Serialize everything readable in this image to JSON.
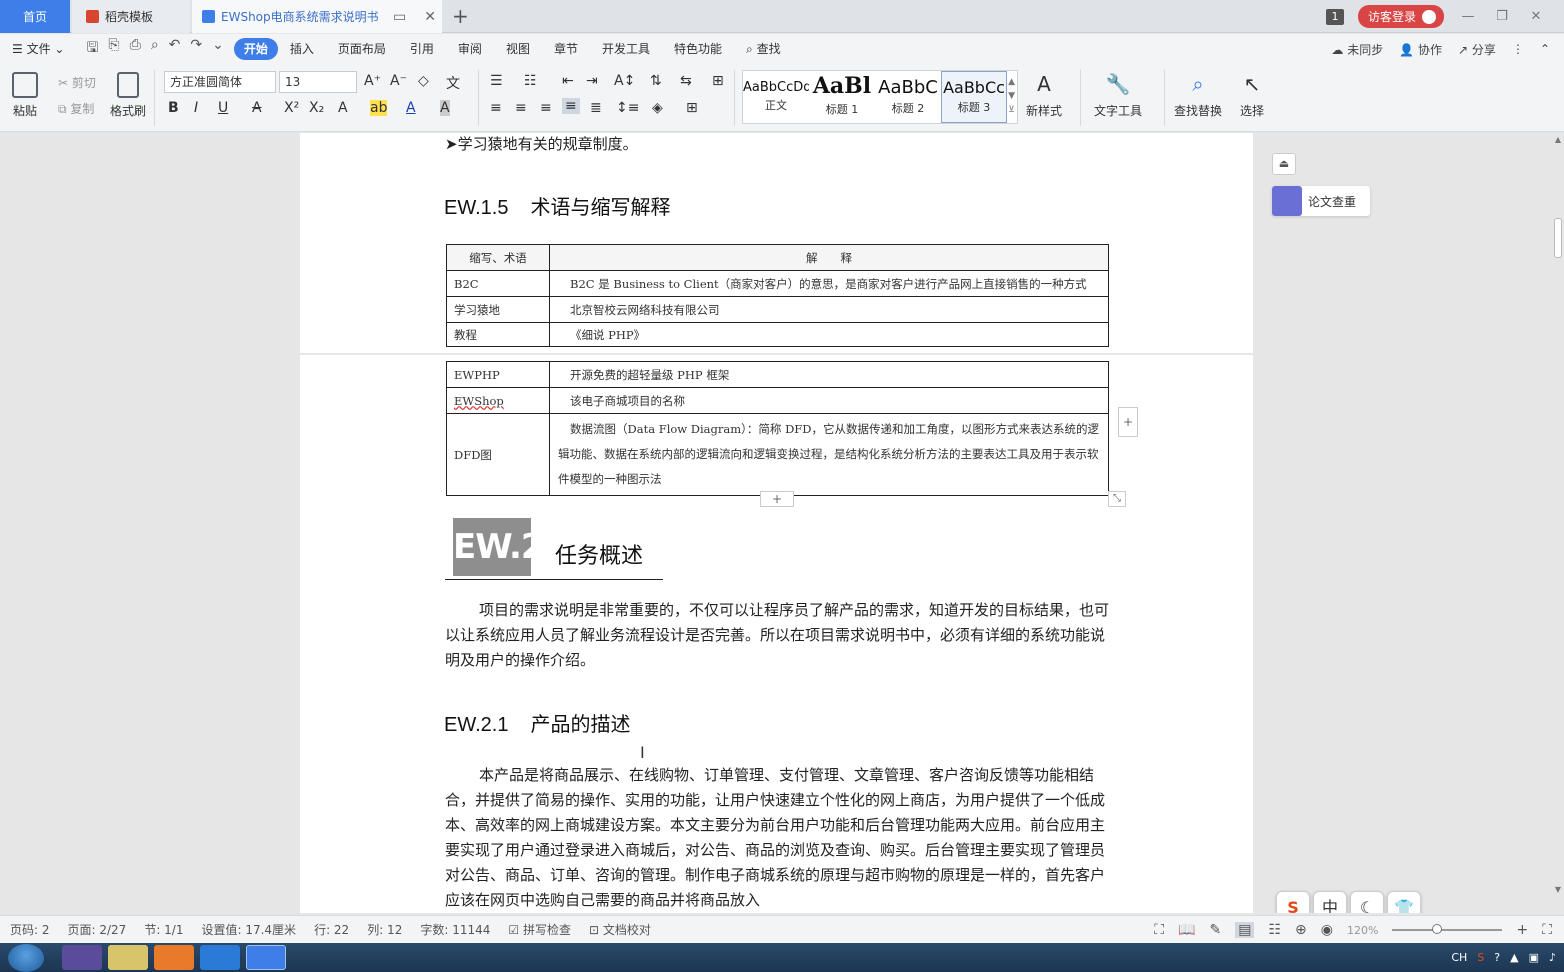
{
  "tabs": {
    "home": "首页",
    "daoke": "稻壳模板",
    "doc": "EWShop电商系统需求说明书",
    "badge": "1",
    "login": "访客登录"
  },
  "menu": {
    "file": "文件",
    "items": [
      "开始",
      "插入",
      "页面布局",
      "引用",
      "审阅",
      "视图",
      "章节",
      "开发工具",
      "特色功能"
    ],
    "search": "查找",
    "right": [
      "未同步",
      "协作",
      "分享"
    ]
  },
  "ribbon": {
    "paste": "粘贴",
    "cut": "剪切",
    "copy": "复制",
    "format_painter": "格式刷",
    "font": "方正准圆简体",
    "size": "13",
    "styles": [
      {
        "sample": "AaBbCcDd",
        "label": "正文"
      },
      {
        "sample": "AaBl",
        "label": "标题 1"
      },
      {
        "sample": "AaBbC",
        "label": "标题 2"
      },
      {
        "sample": "AaBbCc",
        "label": "标题 3"
      }
    ],
    "new_style": "新样式",
    "text_tools": "文字工具",
    "find_replace": "查找替换",
    "select": "选择"
  },
  "doc": {
    "bullet_line": "学习猿地有关的规章制度。",
    "h3_a_num": "EW.1.5",
    "h3_a_text": "术语与缩写解释",
    "table_head": [
      "缩写、术语",
      "解　　释"
    ],
    "rows_a": [
      {
        "term": "B2C",
        "desc": "B2C 是 Business to Client（商家对客户）的意思，是商家对客户进行产品网上直接销售的一种方式"
      },
      {
        "term": "学习猿地",
        "desc": "北京智校云网络科技有限公司"
      },
      {
        "term": "教程",
        "desc": "《细说 PHP》"
      }
    ],
    "rows_b": [
      {
        "term": "EWPHP",
        "desc": "开源免费的超轻量级 PHP 框架"
      },
      {
        "term": "EWShop",
        "desc": "该电子商城项目的名称"
      },
      {
        "term": "DFD图",
        "desc": "数据流图（Data Flow Diagram）：简称 DFD，它从数据传递和加工角度，以图形方式来表达系统的逻辑功能、数据在系统内部的逻辑流向和逻辑变换过程，是结构化系统分析方法的主要表达工具及用于表示软件模型的一种图示法"
      }
    ],
    "h2_badge": "EW.2",
    "h2_title": "任务概述",
    "para1": "项目的需求说明是非常重要的，不仅可以让程序员了解产品的需求，知道开发的目标结果，也可以让系统应用人员了解业务流程设计是否完善。所以在项目需求说明书中，必须有详细的系统功能说明及用户的操作介绍。",
    "h3_b_num": "EW.2.1",
    "h3_b_text": "产品的描述",
    "para2": "本产品是将商品展示、在线购物、订单管理、支付管理、文章管理、客户咨询反馈等功能相结合，并提供了简易的操作、实用的功能，让用户快速建立个性化的网上商店，为用户提供了一个低成本、高效率的网上商城建设方案。本文主要分为前台用户功能和后台管理功能两大应用。前台应用主要实现了用户通过登录进入商城后，对公告、商品的浏览及查询、购买。后台管理主要实现了管理员对公告、商品、订单、咨询的管理。制作电子商城系统的原理与超市购物的原理是一样的，首先客户应该在网页中选购自己需要的商品并将商品放入"
  },
  "side": {
    "plagiarism": "论文查重"
  },
  "ime": [
    "中"
  ],
  "status": {
    "page_code": "页码: 2",
    "pages": "页面: 2/27",
    "section": "节: 1/1",
    "setting": "设置值: 17.4厘米",
    "row": "行: 22",
    "col": "列: 12",
    "words": "字数: 11144",
    "spell": "拼写检查",
    "proof": "文档校对",
    "zoom": "120%"
  },
  "tray": {
    "lang": "CH"
  }
}
